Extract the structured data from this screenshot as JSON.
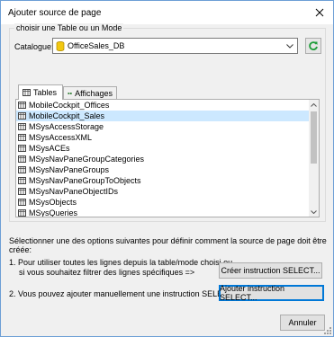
{
  "window": {
    "title": "Ajouter source de page"
  },
  "group": {
    "legend": "choisir une Table ou un Mode"
  },
  "catalogue": {
    "label": "Catalogue:",
    "value": "OfficeSales_DB"
  },
  "tabs": [
    {
      "label": "Tables",
      "selected": true
    },
    {
      "label": "Affichages",
      "selected": false
    }
  ],
  "list": {
    "items": [
      "MobileCockpit_Offices",
      "MobileCockpit_Sales",
      "MSysAccessStorage",
      "MSysAccessXML",
      "MSysACEs",
      "MSysNavPaneGroupCategories",
      "MSysNavPaneGroups",
      "MSysNavPaneGroupToObjects",
      "MSysNavPaneObjectIDs",
      "MSysObjects",
      "MSysQueries"
    ],
    "selected_index": 1
  },
  "instructions": "Sélectionner une des options suivantes pour définir comment la source de page doit être créée:",
  "option1": {
    "line1": "1. Pour utiliser toutes les lignes depuis la table/mode choisi ou",
    "line2": "si vous souhaitez filtrer des lignes spécifiques =>",
    "button": "Créer instruction SELECT..."
  },
  "option2": {
    "text": "2. Vous pouvez ajouter manuellement une instruction SELECT =>",
    "button": "Ajouter instruction SELECT..."
  },
  "footer": {
    "cancel": "Annuler"
  },
  "colors": {
    "accent": "#0078d7",
    "selection": "#cce8ff",
    "refresh": "#1f9d3a",
    "db_icon": "#f2c811"
  }
}
